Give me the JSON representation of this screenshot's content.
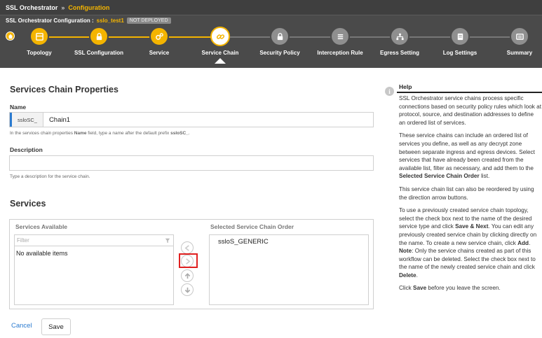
{
  "header": {
    "app_title": "SSL Orchestrator",
    "separator": "»",
    "page": "Configuration",
    "config_label": "SSL Orchestrator Configuration :",
    "config_name": "sslo_test1",
    "deploy_status": "NOT DEPLOYED"
  },
  "wizard": {
    "steps": [
      {
        "label": "Topology",
        "icon": "topology-icon",
        "state": "done"
      },
      {
        "label": "SSL Configuration",
        "icon": "lock-icon",
        "state": "done"
      },
      {
        "label": "Service",
        "icon": "gears-icon",
        "state": "done"
      },
      {
        "label": "Service Chain",
        "icon": "link-icon",
        "state": "current"
      },
      {
        "label": "Security Policy",
        "icon": "lock-icon",
        "state": "todo"
      },
      {
        "label": "Interception Rule",
        "icon": "list-icon",
        "state": "todo"
      },
      {
        "label": "Egress Setting",
        "icon": "network-icon",
        "state": "todo"
      },
      {
        "label": "Log Settings",
        "icon": "log-icon",
        "state": "todo"
      },
      {
        "label": "Summary",
        "icon": "summary-icon",
        "state": "todo"
      }
    ]
  },
  "form": {
    "section_title": "Services Chain Properties",
    "name_label": "Name",
    "name_prefix": "ssloSC_",
    "name_value": "Chain1",
    "name_hint_pre": "In the services chain properties ",
    "name_hint_bold1": "Name",
    "name_hint_mid": " field, type a name after the default prefix ",
    "name_hint_bold2": "ssloSC_",
    "name_hint_end": ".",
    "desc_label": "Description",
    "desc_value": "",
    "desc_hint": "Type a description for the service chain."
  },
  "services": {
    "title": "Services",
    "available_title": "Services Available",
    "filter_placeholder": "Filter",
    "no_items": "No available items",
    "selected_title": "Selected Service Chain Order",
    "selected_items": [
      "ssloS_GENERIC"
    ]
  },
  "actions": {
    "cancel": "Cancel",
    "save": "Save"
  },
  "help": {
    "title": "Help",
    "p1": "SSL Orchestrator service chains process specific connections based on security policy rules which look at protocol, source, and destination addresses to define an ordered list of services.",
    "p2_pre": "These service chains can include an ordered list of services you define, as well as any decrypt zone between separate ingress and egress devices. Select services that have already been created from the available list, filter as necessary, and add them to the ",
    "p2_bold": "Selected Service Chain Order",
    "p2_end": " list.",
    "p3": "This service chain list can also be reordered by using the direction arrow buttons.",
    "p4_a": "To use a previously created service chain topology, select the check box next to the name of the desired service type and click ",
    "p4_b": "Save & Next",
    "p4_c": ". You can edit any previously created service chain by clicking directly on the name. To create a new service chain, click ",
    "p4_d": "Add",
    "p4_e": ". ",
    "p4_f": "Note",
    "p4_g": ": Only the service chains created as part of this workflow can be deleted. Select the check box next to the name of the newly created service chain and click ",
    "p4_h": "Delete",
    "p4_i": ".",
    "p5_a": "Click ",
    "p5_b": "Save",
    "p5_c": " before you leave the screen."
  },
  "colors": {
    "accent": "#f4b400",
    "header_bg": "#4a4a4a",
    "link": "#2b7bd0",
    "highlight": "#e02020"
  }
}
